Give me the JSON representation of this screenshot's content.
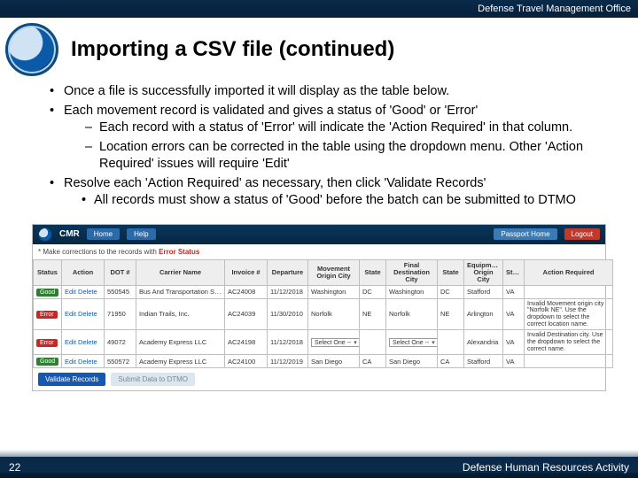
{
  "header": {
    "org": "Defense Travel Management Office"
  },
  "title": "Importing a CSV file (continued)",
  "bullets": {
    "b1": "Once a file is successfully imported it will display as the table below.",
    "b2": "Each movement record is validated and gives a status of 'Good' or 'Error'",
    "b2a": "Each record with a status of 'Error' will indicate the 'Action Required' in that column.",
    "b2b": "Location errors can be corrected in the table using the dropdown menu. Other 'Action Required' issues will require 'Edit'",
    "b3": "Resolve each 'Action Required' as necessary, then click 'Validate Records'",
    "b3a": "All records must show a status of 'Good' before the batch can be submitted to DTMO"
  },
  "shot": {
    "brand": "CMR",
    "tabs": {
      "home": "Home",
      "help": "Help"
    },
    "topbtn_home": "Passport Home",
    "topbtn_logout": "Logout",
    "note_pre": "* Make corrections to the records with ",
    "note_err": "Error Status",
    "headers": {
      "status": "Status",
      "action": "Action",
      "dot": "DOT #",
      "carrier": "Carrier Name",
      "inv": "Invoice #",
      "dep": "Departure",
      "moc": "Movement Origin City",
      "mos": "State",
      "fdc": "Final Destination City",
      "fds": "State",
      "eoc": "Equipment Origin City",
      "eos": "State",
      "ar": "Action Required"
    },
    "rows": [
      {
        "status": "Good",
        "dot": "550545",
        "carrier": "Bus And Transportation Services Inc",
        "inv": "AC24008",
        "dep": "11/12/2018",
        "moc": "Washington",
        "mos": "DC",
        "fdc": "Washington",
        "fds": "DC",
        "eoc": "Stafford",
        "eos": "VA",
        "ar": ""
      },
      {
        "status": "Error",
        "dot": "71950",
        "carrier": "Indian Trails, Inc.",
        "inv": "AC24039",
        "dep": "11/30/2010",
        "moc": "Norfolk",
        "mos": "NE",
        "fdc": "Norfolk",
        "fds": "NE",
        "eoc": "Arlington",
        "eos": "VA",
        "ar": "Invalid Movement origin city \"Norfolk NE\". Use the dropdown to select the correct location name."
      },
      {
        "status": "Error",
        "dot": "49072",
        "carrier": "Academy Express LLC",
        "inv": "AC24198",
        "dep": "11/12/2018",
        "moc_sel": "Select One --",
        "mos": "",
        "fdc_sel": "Select One --",
        "fds": "",
        "eoc": "Alexandria",
        "eos": "VA",
        "ar": "Invalid Destination city. Use the dropdown to select the correct name."
      },
      {
        "status": "Good",
        "dot": "550572",
        "carrier": "Academy Express LLC",
        "inv": "AC24100",
        "dep": "11/12/2019",
        "moc": "San Diego",
        "mos": "CA",
        "fdc": "San Diego",
        "fds": "CA",
        "eoc": "Stafford",
        "eos": "VA",
        "ar": ""
      }
    ],
    "action_edit": "Edit",
    "action_delete": "Delete",
    "btn_validate": "Validate Records",
    "btn_submit": "Submit Data to DTMO"
  },
  "footer": {
    "page": "22",
    "right": "Defense Human Resources Activity"
  }
}
